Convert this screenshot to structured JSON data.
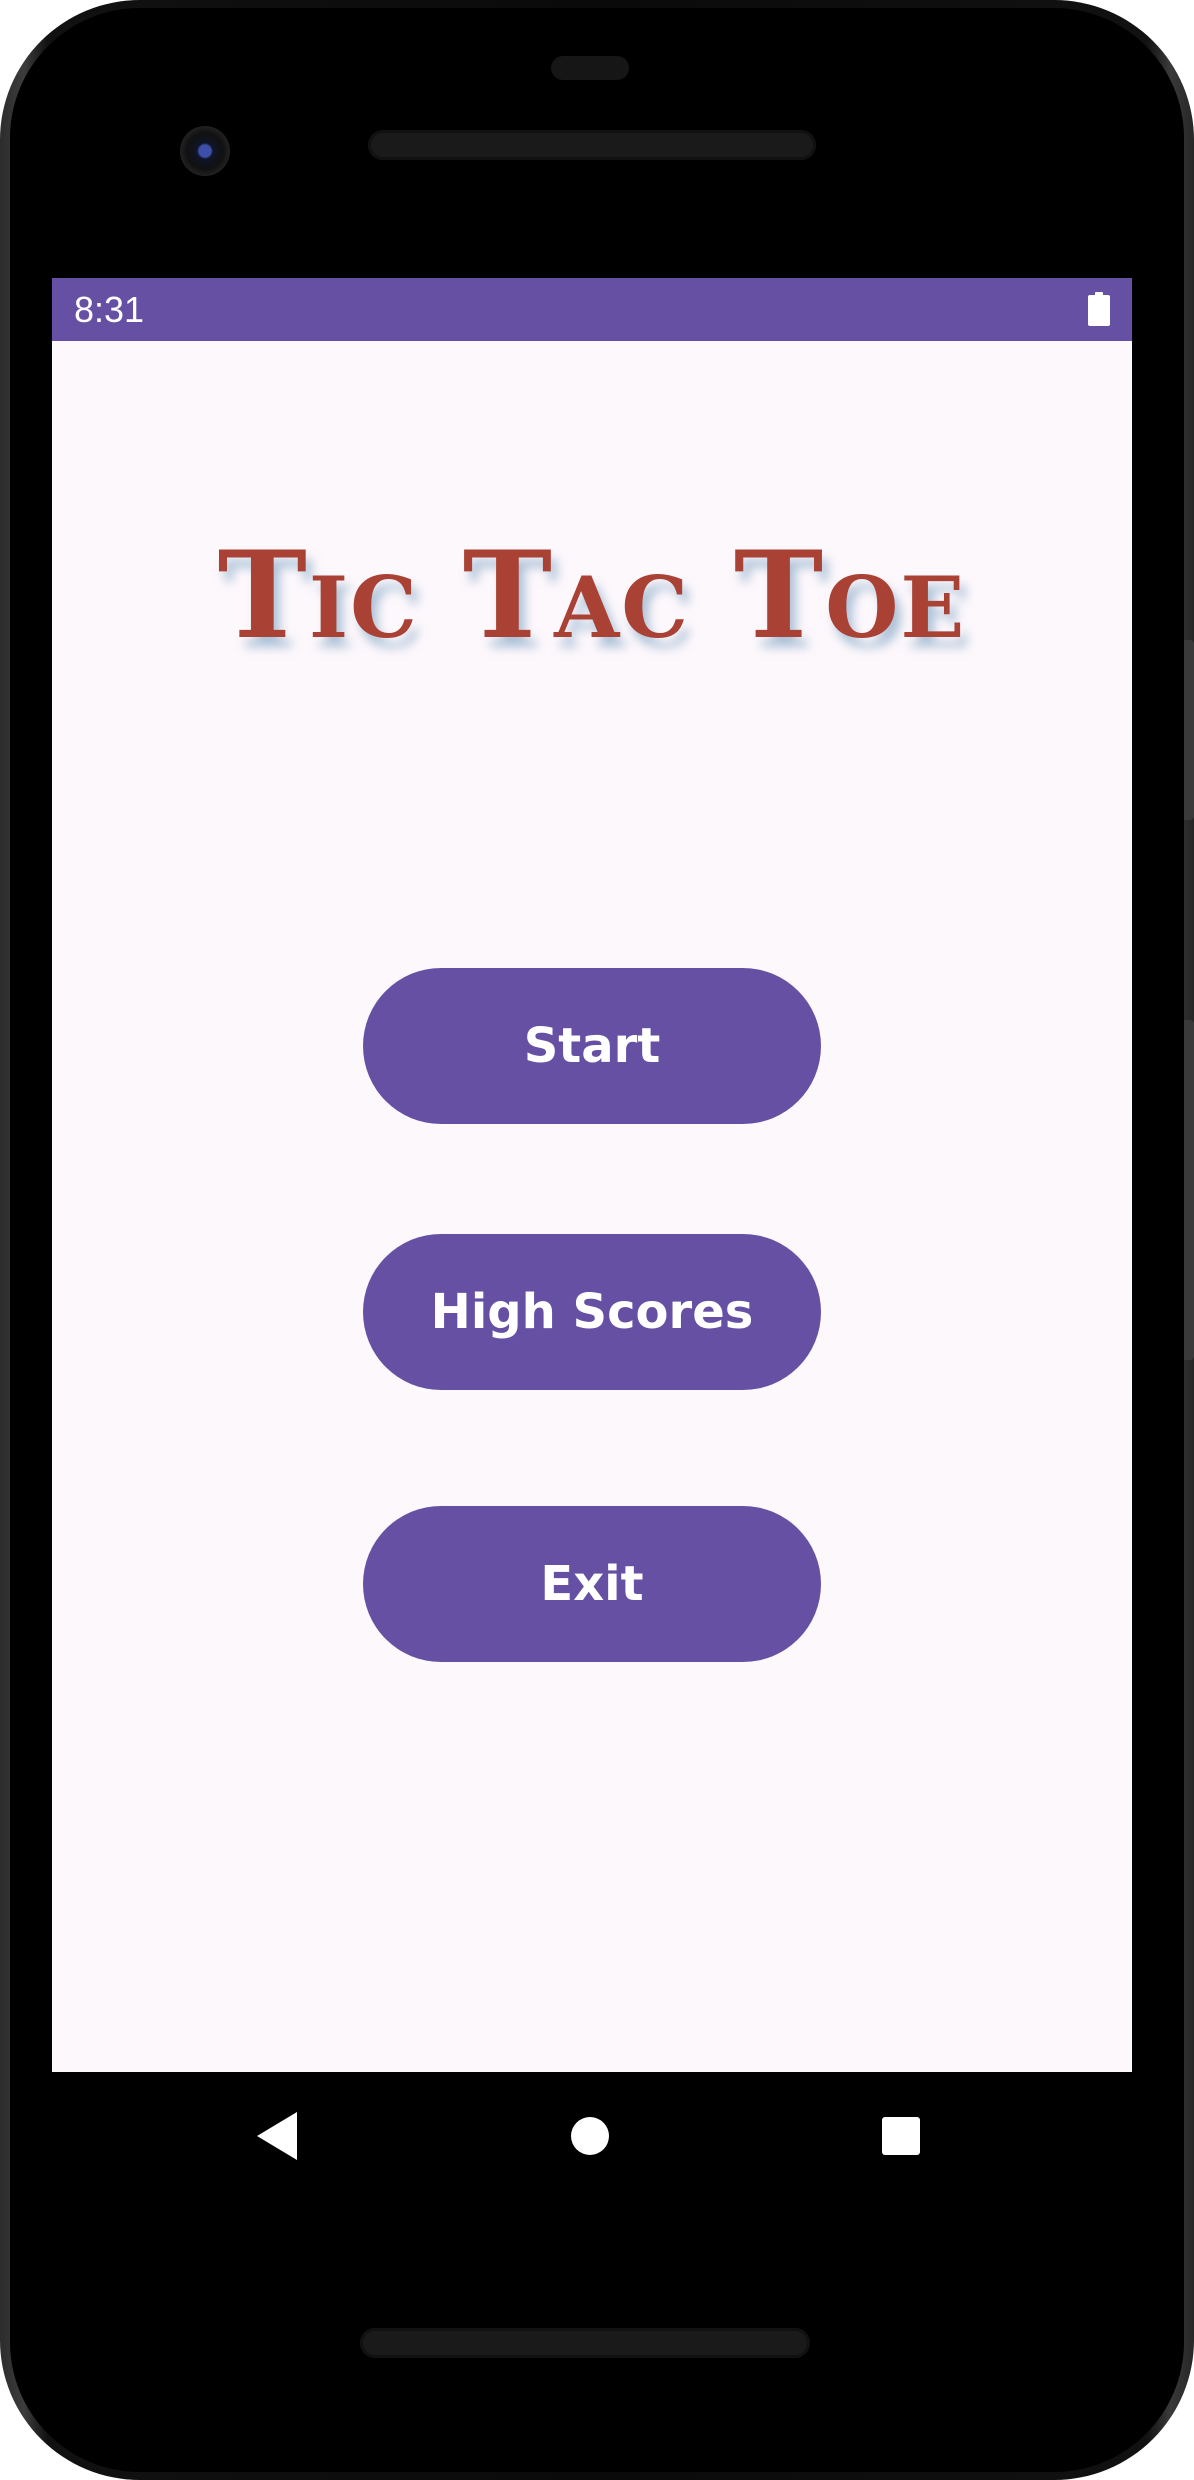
{
  "status_bar": {
    "time": "8:31",
    "battery_icon": "battery-full-icon"
  },
  "app": {
    "title": "Tic Tac Toe"
  },
  "menu": {
    "start_label": "Start",
    "high_scores_label": "High Scores",
    "exit_label": "Exit"
  },
  "nav_bar": {
    "back_icon": "back-triangle-icon",
    "home_icon": "home-circle-icon",
    "recents_icon": "recents-square-icon"
  },
  "colors": {
    "primary": "#6650a4",
    "title": "#a94234",
    "background": "#fdf8fc"
  }
}
